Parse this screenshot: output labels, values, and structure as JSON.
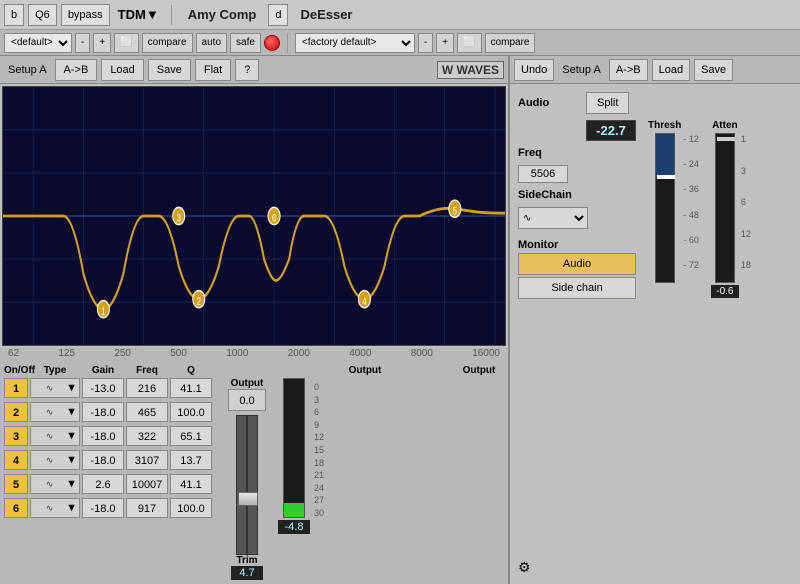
{
  "topbar": {
    "left_btn": "b",
    "plugin_id": "Q6",
    "bypass_label": "bypass",
    "tdm_label": "TDM▼",
    "plugin_name_left": "Amy Comp",
    "d_label": "d",
    "plugin_name_right": "DeEsser"
  },
  "secondbar_left": {
    "preset": "<default>",
    "minus_label": "-",
    "plus_label": "+",
    "compare_label": "compare",
    "auto_label": "auto",
    "safe_label": "safe"
  },
  "secondbar_right": {
    "preset": "<factory default>",
    "minus_label": "-",
    "plus_label": "+",
    "compare_label": "compare"
  },
  "eq_panel": {
    "setup_label": "Setup A",
    "ab_btn": "A->B",
    "load_btn": "Load",
    "save_btn": "Save",
    "flat_btn": "Flat",
    "help_btn": "?",
    "waves_logo": "W WAVES",
    "freq_labels": [
      "62",
      "125",
      "250",
      "500",
      "1000",
      "2000",
      "4000",
      "8000",
      "16000"
    ],
    "output_label": "Output",
    "trim_label": "Trim",
    "trim_value": "4.7",
    "output_meter_value": "-4.8",
    "meter_scale": [
      "0",
      "3",
      "6",
      "9",
      "12",
      "15",
      "18",
      "21",
      "24",
      "27",
      "30"
    ],
    "bands": [
      {
        "num": "1",
        "on": true,
        "type": "notch",
        "gain": "-13.0",
        "freq": "216",
        "q": "41.1"
      },
      {
        "num": "2",
        "on": true,
        "type": "notch",
        "gain": "-18.0",
        "freq": "465",
        "q": "100.0"
      },
      {
        "num": "3",
        "on": true,
        "type": "notch",
        "gain": "-18.0",
        "freq": "322",
        "q": "65.1"
      },
      {
        "num": "4",
        "on": true,
        "type": "notch",
        "gain": "-18.0",
        "freq": "3107",
        "q": "13.7"
      },
      {
        "num": "5",
        "on": true,
        "type": "notch",
        "gain": "2.6",
        "freq": "10007",
        "q": "41.1"
      },
      {
        "num": "6",
        "on": true,
        "type": "notch",
        "gain": "-18.0",
        "freq": "917",
        "q": "100.0"
      }
    ],
    "band_headers": {
      "on_off": "On/Off",
      "type": "Type",
      "gain": "Gain",
      "freq": "Freq",
      "q": "Q"
    },
    "output_section": {
      "output_label": "Output",
      "value": "0.0"
    }
  },
  "de_esser_panel": {
    "undo_btn": "Undo",
    "setup_label": "Setup A",
    "ab_btn": "A->B",
    "load_btn": "Load",
    "save_btn": "Save",
    "audio_label": "Audio",
    "split_btn": "Split",
    "thresh_label": "Thresh",
    "atten_label": "Atten",
    "thresh_value": "-22.7",
    "freq_label": "Freq",
    "freq_value": "5506",
    "sidechain_label": "SideChain",
    "monitor_label": "Monitor",
    "audio_btn": "Audio",
    "sidechain_btn": "Side chain",
    "thresh_scale": [
      "-12",
      "-24",
      "-36",
      "-48",
      "-60",
      "-72"
    ],
    "atten_scale": [
      "1",
      "3",
      "6",
      "12",
      "18"
    ],
    "atten_value": "-0.6",
    "icon_gear": "⚙"
  }
}
